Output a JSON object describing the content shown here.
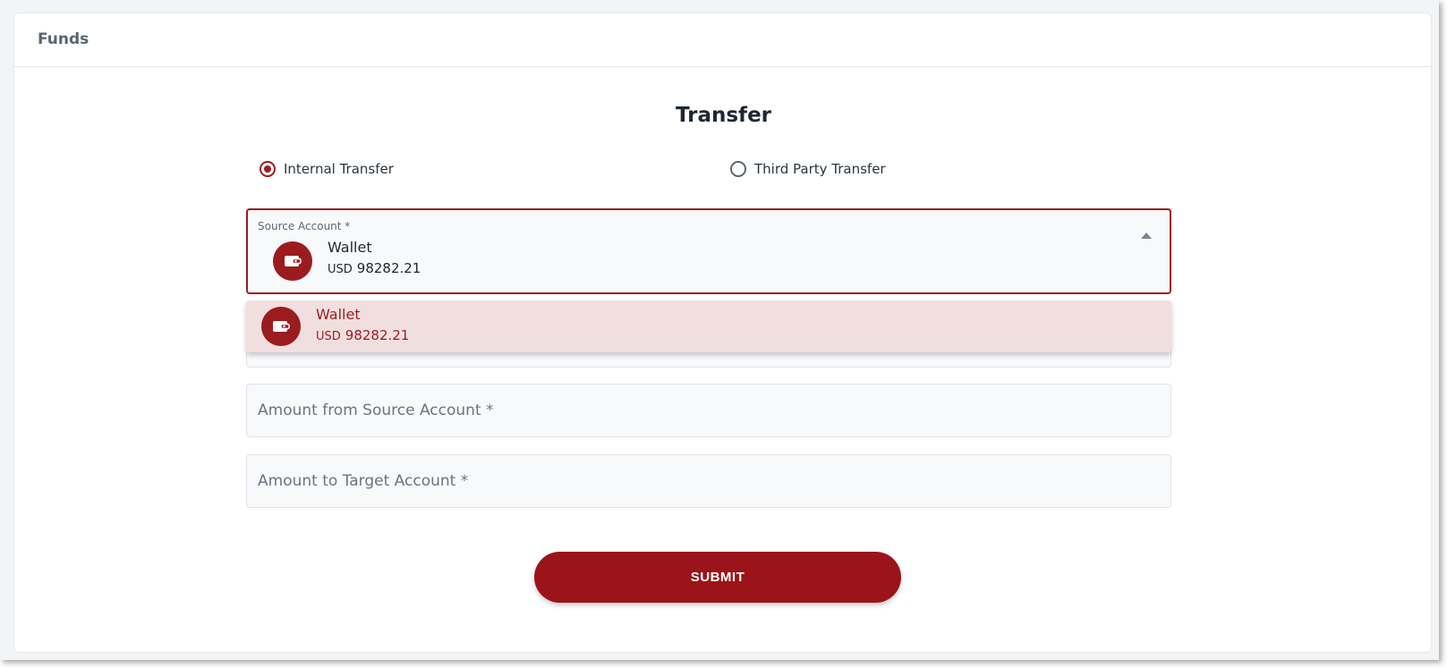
{
  "header": {
    "title": "Funds"
  },
  "form": {
    "title": "Transfer",
    "transfer_types": [
      {
        "label": "Internal Transfer",
        "selected": true
      },
      {
        "label": "Third Party Transfer",
        "selected": false
      }
    ],
    "source_account": {
      "label": "Source Account *",
      "selected": {
        "name": "Wallet",
        "currency": "USD",
        "balance": "98282.21"
      },
      "icon": "wallet-icon"
    },
    "dropdown_options": [
      {
        "name": "Wallet",
        "currency": "USD",
        "balance": "98282.21",
        "highlighted": true,
        "icon": "wallet-icon"
      }
    ],
    "amount_source": {
      "placeholder": "Amount from Source Account *"
    },
    "amount_target": {
      "placeholder": "Amount to Target Account *"
    },
    "submit_label": "SUBMIT"
  },
  "colors": {
    "accent": "#9b1c1f",
    "highlight": "#f1dfe0"
  }
}
